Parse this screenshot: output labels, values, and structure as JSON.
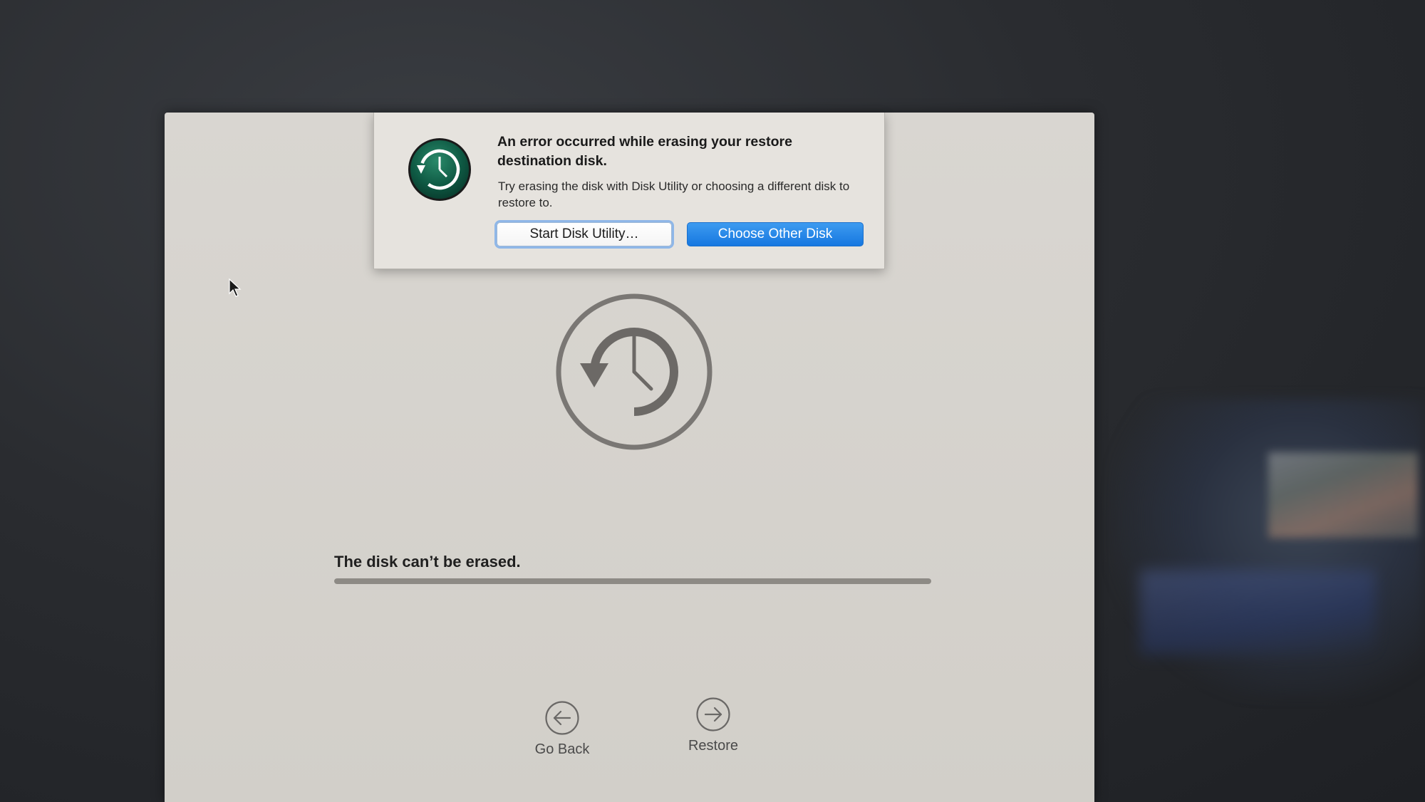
{
  "alert": {
    "title": "An error occurred while erasing your restore destination disk.",
    "message": "Try erasing the disk with Disk Utility or choosing a different disk to restore to.",
    "secondary_button": "Start Disk Utility…",
    "primary_button": "Choose Other Disk",
    "icon": "time-machine-icon"
  },
  "main": {
    "glyph": "time-machine-icon",
    "status": "The disk can’t be erased.",
    "progress": 1.0
  },
  "nav": {
    "back_label": "Go Back",
    "back_icon": "arrow-left-icon",
    "restore_label": "Restore",
    "restore_icon": "arrow-right-icon"
  },
  "colors": {
    "primary_button": "#1677e0",
    "focus_ring": "#8fb7e8",
    "icon_green": "#0f5a44"
  }
}
